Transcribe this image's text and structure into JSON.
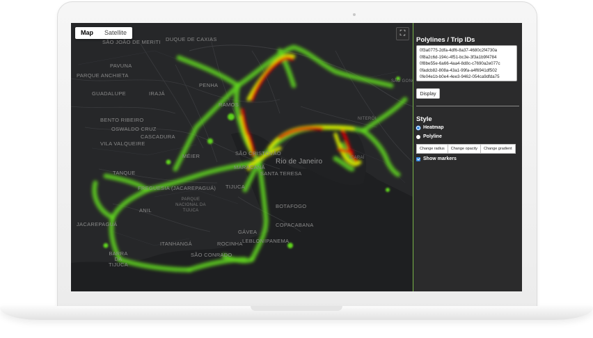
{
  "map": {
    "type_buttons": [
      "Map",
      "Satellite"
    ],
    "active_type": "Map",
    "fullscreen_icon": "fullscreen-icon",
    "city_label": "Rio de Janeiro",
    "places": [
      "DUQUE DE CAXIAS",
      "SÃO JOÃO DE MERITI",
      "PAVUNA",
      "PARQUE ANCHIETA",
      "GUADALUPE",
      "IRAJÁ",
      "PENHA",
      "RAMOS",
      "BENTO RIBEIRO",
      "OSWALDO CRUZ",
      "CASCADURA",
      "VILA VALQUEIRE",
      "MÉIER",
      "SÃO CRISTÓVÃO",
      "MARACANÃ",
      "SANTA TERESA",
      "TANQUE",
      "FREGUESIA (JACAREPAGUÁ)",
      "TIJUCA",
      "ANIL",
      "JACAREPAGUÁ",
      "PARQUE NACIONAL DA TIJUCA",
      "BOTAFOGO",
      "GÁVEA",
      "COPACABANA",
      "LEBLON",
      "IPANEMA",
      "ITANHANGÁ",
      "ROCINHA",
      "BARRA DA TIJUCA",
      "SÃO CONRADO",
      "NITERÓI",
      "SÃO GONÇALO",
      "ICARAÍ"
    ],
    "heat_colors": {
      "low": "#5fd31f",
      "mid": "#f0e000",
      "high": "#e00000"
    }
  },
  "panel": {
    "title": "Polylines / Trip IDs",
    "trip_ids": [
      "0f3a0775-2dfa-4df6-8a37-4680c2f4730a",
      "0f8a2c6d-194c-4f51-bc3e-3f3a1b9f4784",
      "0f8be55e-6a66-4aa4-8d8c-c7690a2e077c",
      "0fadcb82-808a-43a1-99fa-a4f6941df502",
      "0fe04e1b-b0e4-4ee3-9462-054ca9dfda75"
    ],
    "display_button": "Display",
    "style_title": "Style",
    "style_options": [
      "Heatmap",
      "Polyline"
    ],
    "selected_style": "Heatmap",
    "buttons": [
      "Change radius",
      "Change opacity",
      "Change gradient"
    ],
    "show_markers_label": "Show markers",
    "show_markers_checked": true,
    "accent_color": "#3a8ee6"
  }
}
